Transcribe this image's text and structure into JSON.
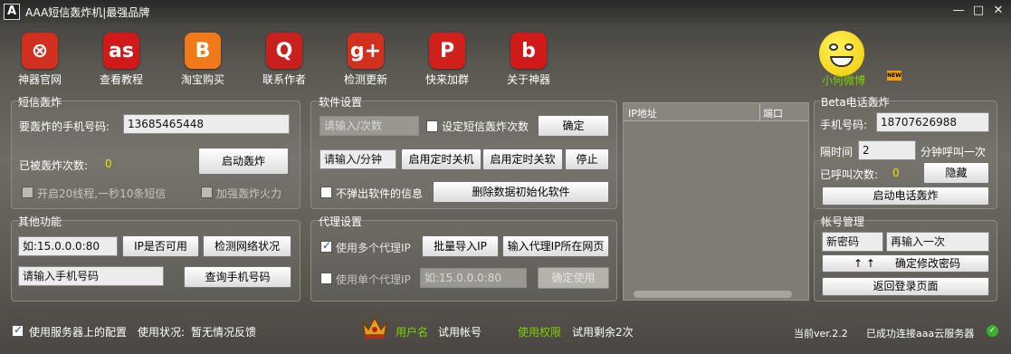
{
  "window": {
    "title": "AAA短信轰炸机|最强品牌",
    "logo": "A",
    "controls": [
      "minimize-icon",
      "maximize-icon",
      "close-icon"
    ]
  },
  "toolbar": [
    {
      "label": "神器官网",
      "icon": "app-store-icon",
      "color": "#d2301f",
      "glyph": "⊗"
    },
    {
      "label": "查看教程",
      "icon": "lastfm-icon",
      "color": "#d01a1a",
      "glyph": "as"
    },
    {
      "label": "淘宝购买",
      "icon": "blogger-icon",
      "color": "#f07a1a",
      "glyph": "B"
    },
    {
      "label": "联系作者",
      "icon": "quora-icon",
      "color": "#c8201c",
      "glyph": "Q"
    },
    {
      "label": "检测更新",
      "icon": "google-plus-icon",
      "color": "#d2301f",
      "glyph": "g+"
    },
    {
      "label": "快来加群",
      "icon": "pinterest-icon",
      "color": "#d0201c",
      "glyph": "P"
    },
    {
      "label": "关于神器",
      "icon": "beats-icon",
      "color": "#d01a1a",
      "glyph": "b"
    }
  ],
  "weibo": {
    "label": "小何微博",
    "badge": "NEW"
  },
  "sms": {
    "title": "短信轰炸",
    "phone_label": "要轰炸的手机号码:",
    "phone_value": "13685465448",
    "count_label": "已被轰炸次数:",
    "count_value": "0",
    "start_button": "启动轰炸",
    "opt_threads": "开启20线程,一秒10条短信",
    "opt_power": "加强轰炸火力"
  },
  "software": {
    "title": "软件设置",
    "count_placeholder": "请输入/次数",
    "set_count_label": "设定短信轰炸次数",
    "confirm": "确定",
    "minute_placeholder": "请输入/分钟",
    "timer_shutdown": "启用定时关机",
    "timer_close": "启用定时关软",
    "stop": "停止",
    "no_popup": "不弹出软件的信息",
    "delete_data": "删除数据初始化软件"
  },
  "iptable": {
    "columns": [
      "IP地址",
      "端口"
    ]
  },
  "beta": {
    "title": "Beta电话轰炸",
    "phone_label": "手机号码:",
    "phone_value": "18707626988",
    "interval_label": "隔时间",
    "interval_value": "2",
    "interval_unit": "分钟呼叫一次",
    "called_label": "已呼叫次数:",
    "called_value": "0",
    "hide": "隐藏",
    "start": "启动电话轰炸"
  },
  "other": {
    "title": "其他功能",
    "ip_value": "如:15.0.0.0:80",
    "ip_check": "IP是否可用",
    "net_check": "检测网络状况",
    "phone_placeholder": "请输入手机号码",
    "phone_query": "查询手机号码"
  },
  "proxy": {
    "title": "代理设置",
    "multi": "使用多个代理IP",
    "batch_import": "批量导入IP",
    "input_location": "输入代理IP所在网页",
    "single": "使用单个代理IP",
    "single_value": "如:15.0.0.0:80",
    "confirm_use": "确定使用"
  },
  "account": {
    "title": "帐号管理",
    "new_pwd": "新密码",
    "repeat": "再输入一次",
    "confirm_change": "确定修改密码",
    "arrows": "↑ ↑",
    "back_login": "返回登录页面"
  },
  "status": {
    "use_server": "使用服务器上的配置",
    "state_label": "使用状况:",
    "state_value": "暂无情况反馈",
    "user_label": "用户名",
    "user_value": "试用帐号",
    "perm_label": "使用权限",
    "perm_value": "试用剩余2次",
    "version": "当前ver.2.2",
    "connected": "已成功连接aaa云服务器"
  }
}
